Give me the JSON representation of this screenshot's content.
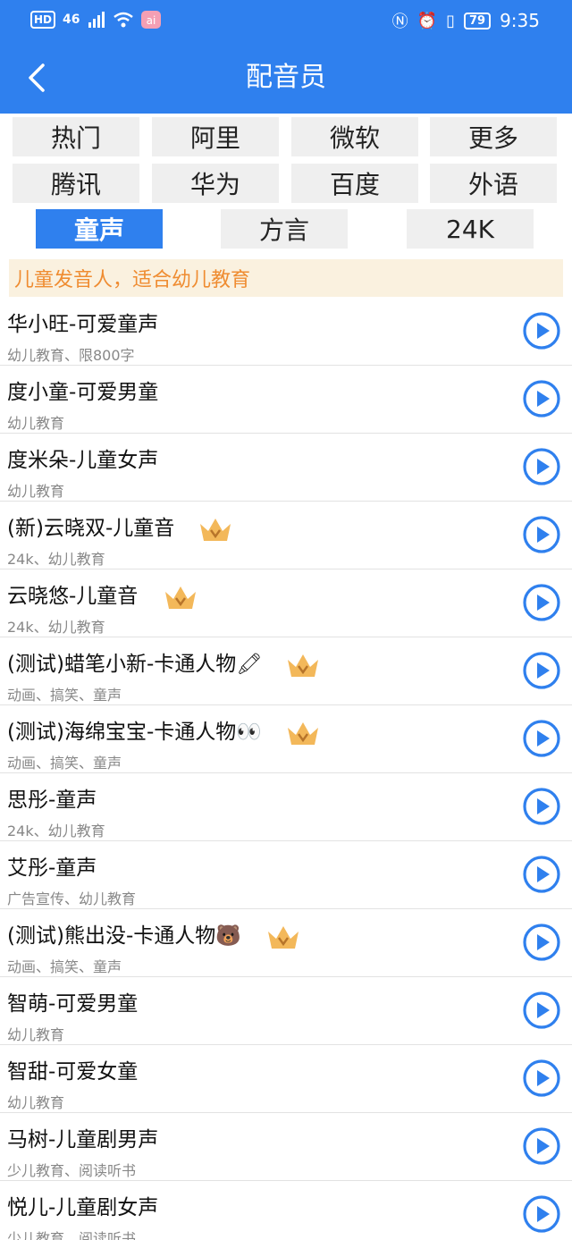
{
  "status_bar": {
    "hd": "HD",
    "signal": "46",
    "battery": "79",
    "time": "9:35"
  },
  "header": {
    "title": "配音员"
  },
  "tabs": [
    {
      "label": "热门"
    },
    {
      "label": "阿里"
    },
    {
      "label": "微软"
    },
    {
      "label": "更多"
    },
    {
      "label": "腾讯"
    },
    {
      "label": "华为"
    },
    {
      "label": "百度"
    },
    {
      "label": "外语"
    },
    {
      "label": "童声",
      "active": true
    },
    {
      "label": "方言"
    },
    {
      "label": "24K"
    }
  ],
  "banner": "儿童发音人，适合幼儿教育",
  "voices": [
    {
      "name": "华小旺-可爱童声",
      "tags": "幼儿教育、限800字",
      "vip": false
    },
    {
      "name": "度小童-可爱男童",
      "tags": "幼儿教育",
      "vip": false
    },
    {
      "name": "度米朵-儿童女声",
      "tags": "幼儿教育",
      "vip": false
    },
    {
      "name": "(新)云晓双-儿童音",
      "tags": "24k、幼儿教育",
      "vip": true
    },
    {
      "name": "云晓悠-儿童音",
      "tags": "24k、幼儿教育",
      "vip": true
    },
    {
      "name": "(测试)蜡笔小新-卡通人物🖍",
      "tags": "动画、搞笑、童声",
      "vip": true
    },
    {
      "name": "(测试)海绵宝宝-卡通人物👀",
      "tags": "动画、搞笑、童声",
      "vip": true
    },
    {
      "name": "思彤-童声",
      "tags": "24k、幼儿教育",
      "vip": false
    },
    {
      "name": "艾彤-童声",
      "tags": "广告宣传、幼儿教育",
      "vip": false
    },
    {
      "name": "(测试)熊出没-卡通人物🐻",
      "tags": "动画、搞笑、童声",
      "vip": true
    },
    {
      "name": "智萌-可爱男童",
      "tags": "幼儿教育",
      "vip": false
    },
    {
      "name": "智甜-可爱女童",
      "tags": "幼儿教育",
      "vip": false
    },
    {
      "name": "马树-儿童剧男声",
      "tags": "少儿教育、阅读听书",
      "vip": false
    },
    {
      "name": "悦儿-儿童剧女声",
      "tags": "少儿教育、阅读听书",
      "vip": false
    }
  ],
  "colors": {
    "accent": "#2f80ee",
    "banner_text": "#ef8c31",
    "banner_bg": "#faf1df",
    "crown": "#f3b85a"
  },
  "icons": {
    "back": "back-arrow-icon",
    "play": "play-circle-icon",
    "vip": "crown-icon"
  }
}
